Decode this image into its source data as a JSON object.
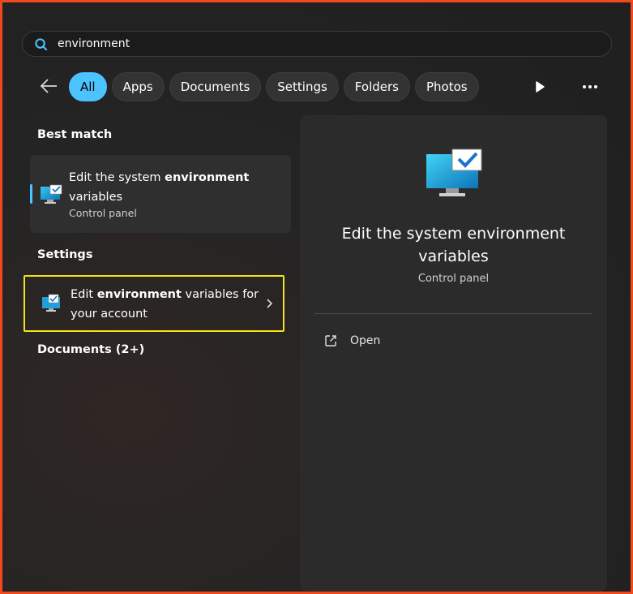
{
  "search": {
    "value": "environment",
    "icon": "search-icon"
  },
  "filters": {
    "items": [
      {
        "label": "All",
        "active": true
      },
      {
        "label": "Apps"
      },
      {
        "label": "Documents"
      },
      {
        "label": "Settings"
      },
      {
        "label": "Folders"
      },
      {
        "label": "Photos"
      }
    ]
  },
  "best_match": {
    "header": "Best match",
    "title_pre": "Edit the system ",
    "title_bold": "environment",
    "title_post": " variables",
    "subtitle": "Control panel"
  },
  "settings": {
    "header": "Settings",
    "title_pre": "Edit ",
    "title_bold": "environment",
    "title_post": " variables for your account"
  },
  "documents": {
    "header": "Documents (2+)"
  },
  "preview": {
    "title": "Edit the system environment variables",
    "subtitle": "Control panel",
    "actions": [
      {
        "label": "Open",
        "icon": "open-external-icon"
      }
    ]
  },
  "colors": {
    "accent": "#4cc2ff",
    "highlight_border": "#f5e21b",
    "frame": "#f04a1c"
  }
}
